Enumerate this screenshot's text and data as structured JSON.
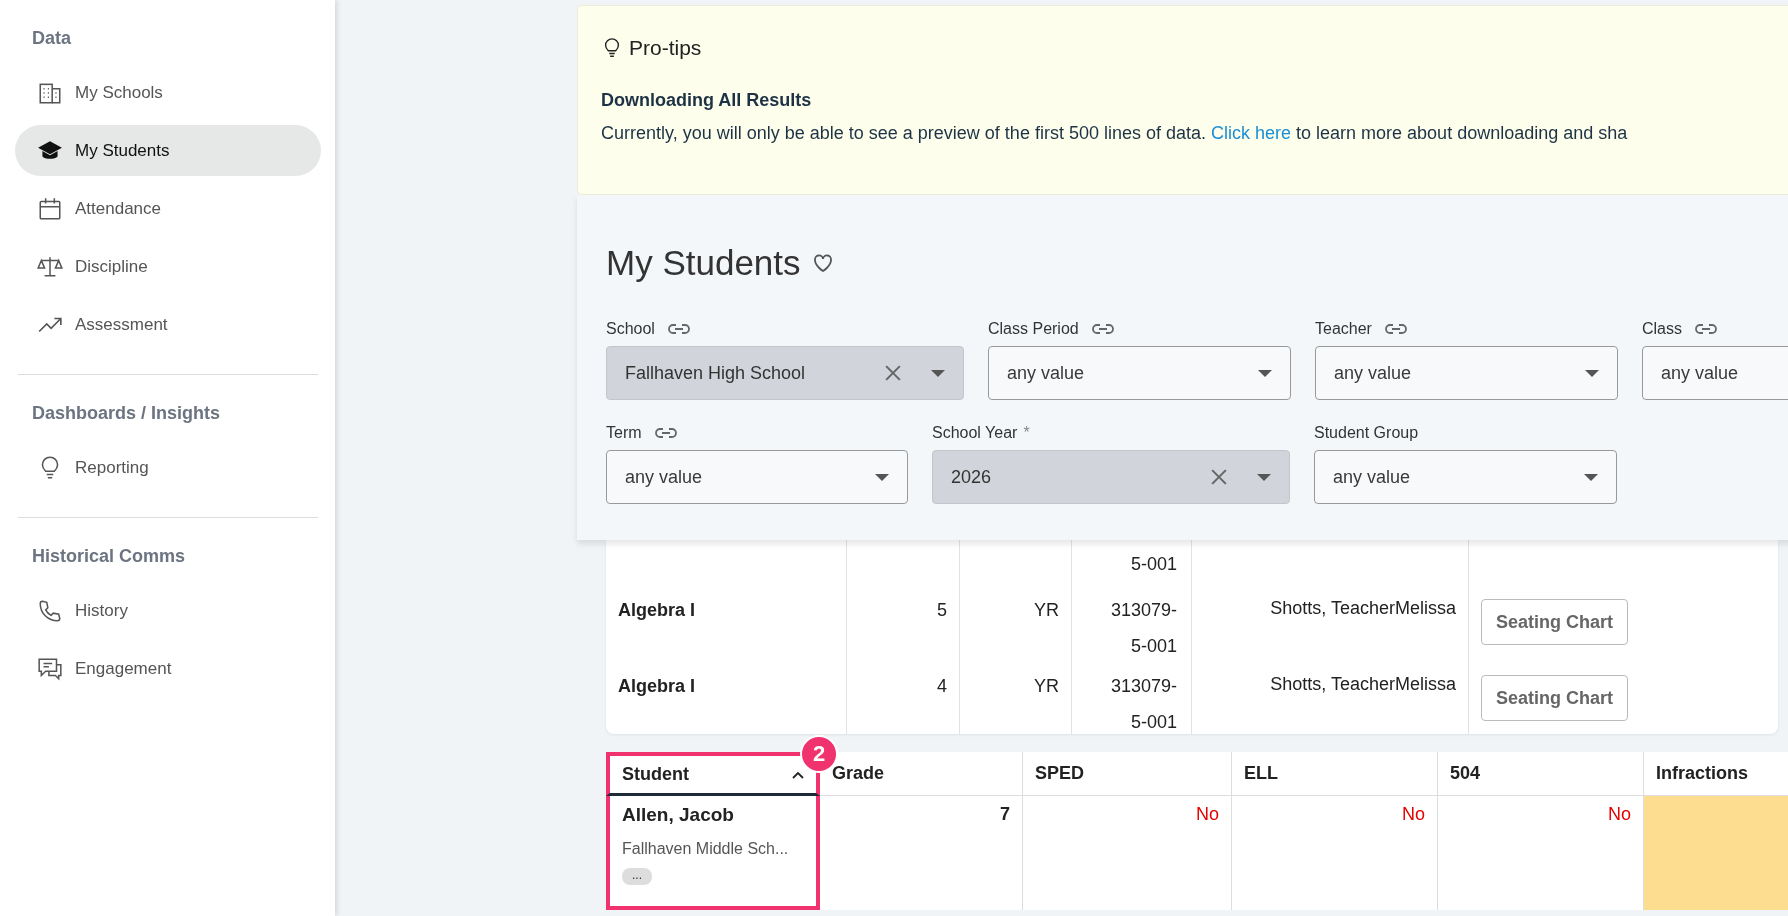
{
  "sidebar": {
    "sections": [
      {
        "title": "Data",
        "items": [
          {
            "label": "My Schools",
            "selected": false
          },
          {
            "label": "My Students",
            "selected": true
          },
          {
            "label": "Attendance",
            "selected": false
          },
          {
            "label": "Discipline",
            "selected": false
          },
          {
            "label": "Assessment",
            "selected": false
          }
        ]
      },
      {
        "title": "Dashboards / Insights",
        "items": [
          {
            "label": "Reporting",
            "selected": false
          }
        ]
      },
      {
        "title": "Historical Comms",
        "items": [
          {
            "label": "History",
            "selected": false
          },
          {
            "label": "Engagement",
            "selected": false
          }
        ]
      }
    ]
  },
  "protips": {
    "title": "Pro-tips",
    "heading": "Downloading All Results",
    "text_before": "Currently, you will only be able to see a preview of the first 500 lines of data.",
    "link": "Click here",
    "text_after": "to learn more about downloading and sha"
  },
  "page_title": "My Students",
  "filter_rows": [
    [
      {
        "label": "School",
        "linkable": true,
        "value": "Fallhaven High School"
      },
      {
        "label": "Class Period",
        "linkable": true,
        "placeholder": "any value"
      },
      {
        "label": "Teacher",
        "linkable": true,
        "placeholder": "any value"
      },
      {
        "label": "Class",
        "linkable": true,
        "placeholder": "any value"
      }
    ],
    [
      {
        "label": "Term",
        "linkable": true,
        "placeholder": "any value"
      },
      {
        "label": "School Year",
        "linkable": false,
        "required_mark": "*",
        "value": "2026"
      },
      {
        "label": "Student Group",
        "linkable": false,
        "placeholder": "any value"
      }
    ]
  ],
  "class_table": {
    "partial_row": {
      "section": "5-001"
    },
    "rows": [
      {
        "course": "Algebra I",
        "period": "5",
        "term": "YR",
        "section": "313079-5-001",
        "teacher": "Shotts, TeacherMelissa",
        "action": "Seating Chart"
      },
      {
        "course": "Algebra I",
        "period": "4",
        "term": "YR",
        "section": "313079-5-001",
        "teacher": "Shotts, TeacherMelissa",
        "action": "Seating Chart"
      }
    ]
  },
  "student_table": {
    "columns": [
      {
        "label": "Student",
        "sorted": true
      },
      {
        "label": "Grade",
        "sorted": false
      },
      {
        "label": "SPED",
        "sorted": false
      },
      {
        "label": "ELL",
        "sorted": false
      },
      {
        "label": "504",
        "sorted": false
      },
      {
        "label": "Infractions",
        "sorted": false
      }
    ],
    "rows": [
      {
        "name": "Allen, Jacob",
        "school": "Fallhaven Middle Sch...",
        "more": "...",
        "grade": "7",
        "sped": "No",
        "ell": "No",
        "s504": "No"
      }
    ]
  },
  "annotation": {
    "badge": "2"
  }
}
